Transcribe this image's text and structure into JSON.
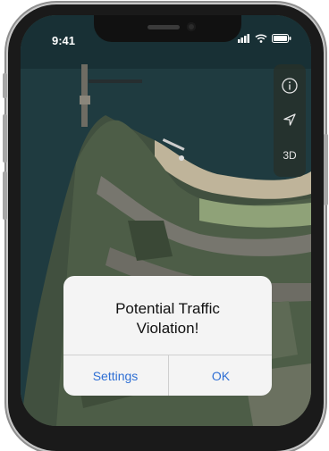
{
  "status_bar": {
    "time": "9:41"
  },
  "map_controls": {
    "info_icon": "info-icon",
    "location_icon": "location-arrow-icon",
    "mode_3d_label": "3D"
  },
  "alert": {
    "title": "Potential Traffic Violation!",
    "settings_label": "Settings",
    "ok_label": "OK",
    "accent_color": "#2f6fd4"
  }
}
